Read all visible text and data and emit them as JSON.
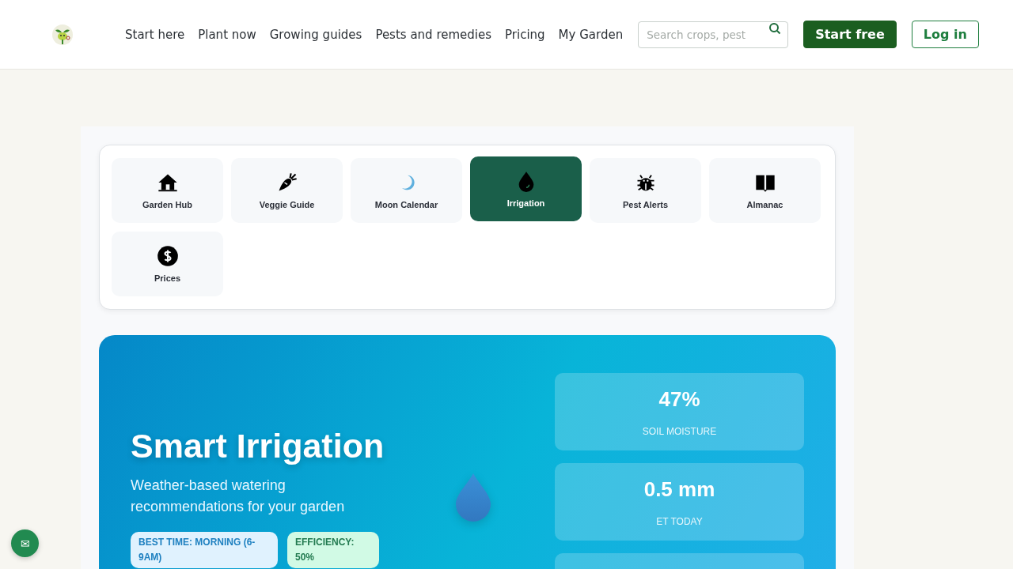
{
  "header": {
    "nav": [
      "Start here",
      "Plant now",
      "Growing guides",
      "Pests and remedies",
      "Pricing",
      "My Garden"
    ],
    "search": {
      "placeholder": "Search crops, pest"
    },
    "buttons": [
      {
        "label": "Start free",
        "kind": "primary"
      },
      {
        "label": "Log in",
        "kind": "outline"
      }
    ]
  },
  "tools": [
    {
      "label": "Garden Hub",
      "selected": false
    },
    {
      "label": "Veggie Guide",
      "selected": false
    },
    {
      "label": "Moon Calendar",
      "selected": false
    },
    {
      "label": "Irrigation",
      "selected": true
    },
    {
      "label": "Pest Alerts",
      "selected": false
    },
    {
      "label": "Almanac",
      "selected": false
    },
    {
      "label": "Prices",
      "selected": false
    }
  ],
  "hero": {
    "title": "Smart Irrigation",
    "subtitle": "Weather-based watering recommendations for your garden",
    "badges": [
      {
        "text": "BEST TIME: MORNING (6-9AM)",
        "kind": "info"
      },
      {
        "text": "EFFICIENCY: 50%",
        "kind": "success"
      }
    ],
    "stats": [
      {
        "value": "47%",
        "label": "SOIL MOISTURE"
      },
      {
        "value": "0.5 mm",
        "label": "ET TODAY"
      }
    ]
  },
  "chat_button": {
    "icon": "✉"
  }
}
